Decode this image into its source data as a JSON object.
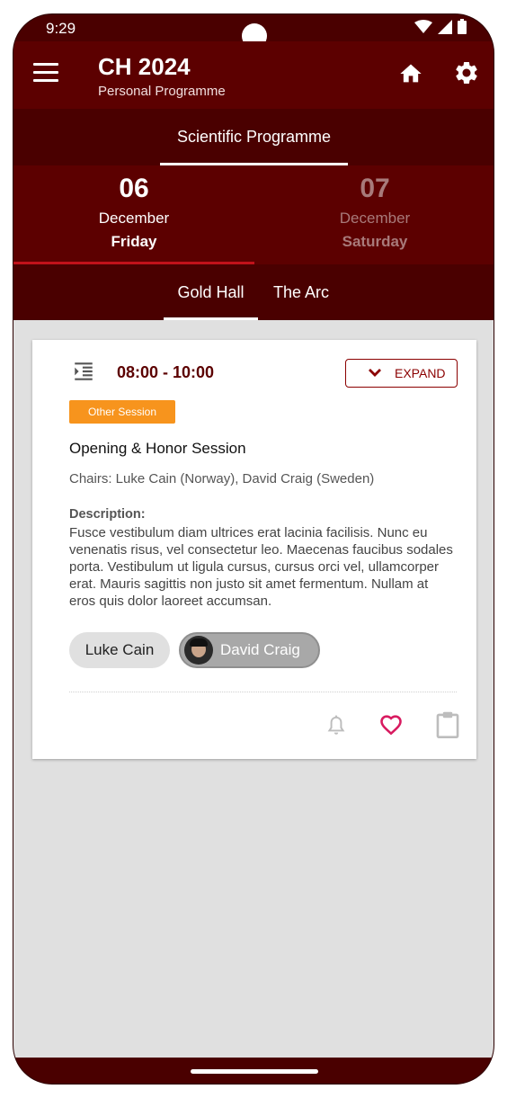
{
  "status_bar": {
    "time": "9:29"
  },
  "app_bar": {
    "title": "CH 2024",
    "subtitle": "Personal Programme"
  },
  "top_tabs": [
    {
      "label": "Scientific Programme",
      "selected": true
    }
  ],
  "date_tabs": [
    {
      "day": "06",
      "month": "December",
      "weekday": "Friday",
      "selected": true
    },
    {
      "day": "07",
      "month": "December",
      "weekday": "Saturday",
      "selected": false
    }
  ],
  "hall_tabs": [
    {
      "label": "Gold Hall",
      "selected": true
    },
    {
      "label": "The Arc",
      "selected": false
    }
  ],
  "session": {
    "time": "08:00 - 10:00",
    "expand_label": "EXPAND",
    "tag": "Other Session",
    "tag_color": "#f7941d",
    "title": "Opening & Honor Session",
    "chairs": "Chairs: Luke Cain (Norway), David Craig (Sweden)",
    "description_label": "Description:",
    "description": "Fusce vestibulum diam ultrices erat lacinia facilisis. Nunc eu venenatis risus, vel consectetur leo. Maecenas faucibus sodales porta. Vestibulum ut ligula cursus, cursus orci vel, ullamcorper erat. Mauris sagittis non justo sit amet fermentum. Nullam at eros quis dolor laoreet accumsan.",
    "speakers": [
      {
        "name": "Luke Cain",
        "has_photo": false
      },
      {
        "name": "David Craig",
        "has_photo": true
      }
    ],
    "actions": [
      "bell-icon",
      "heart-icon",
      "clipboard-icon"
    ]
  },
  "colors": {
    "primary": "#5c0000",
    "primary_dark": "#4a0000",
    "accent": "#c1121a",
    "favorite": "#d81b60"
  }
}
